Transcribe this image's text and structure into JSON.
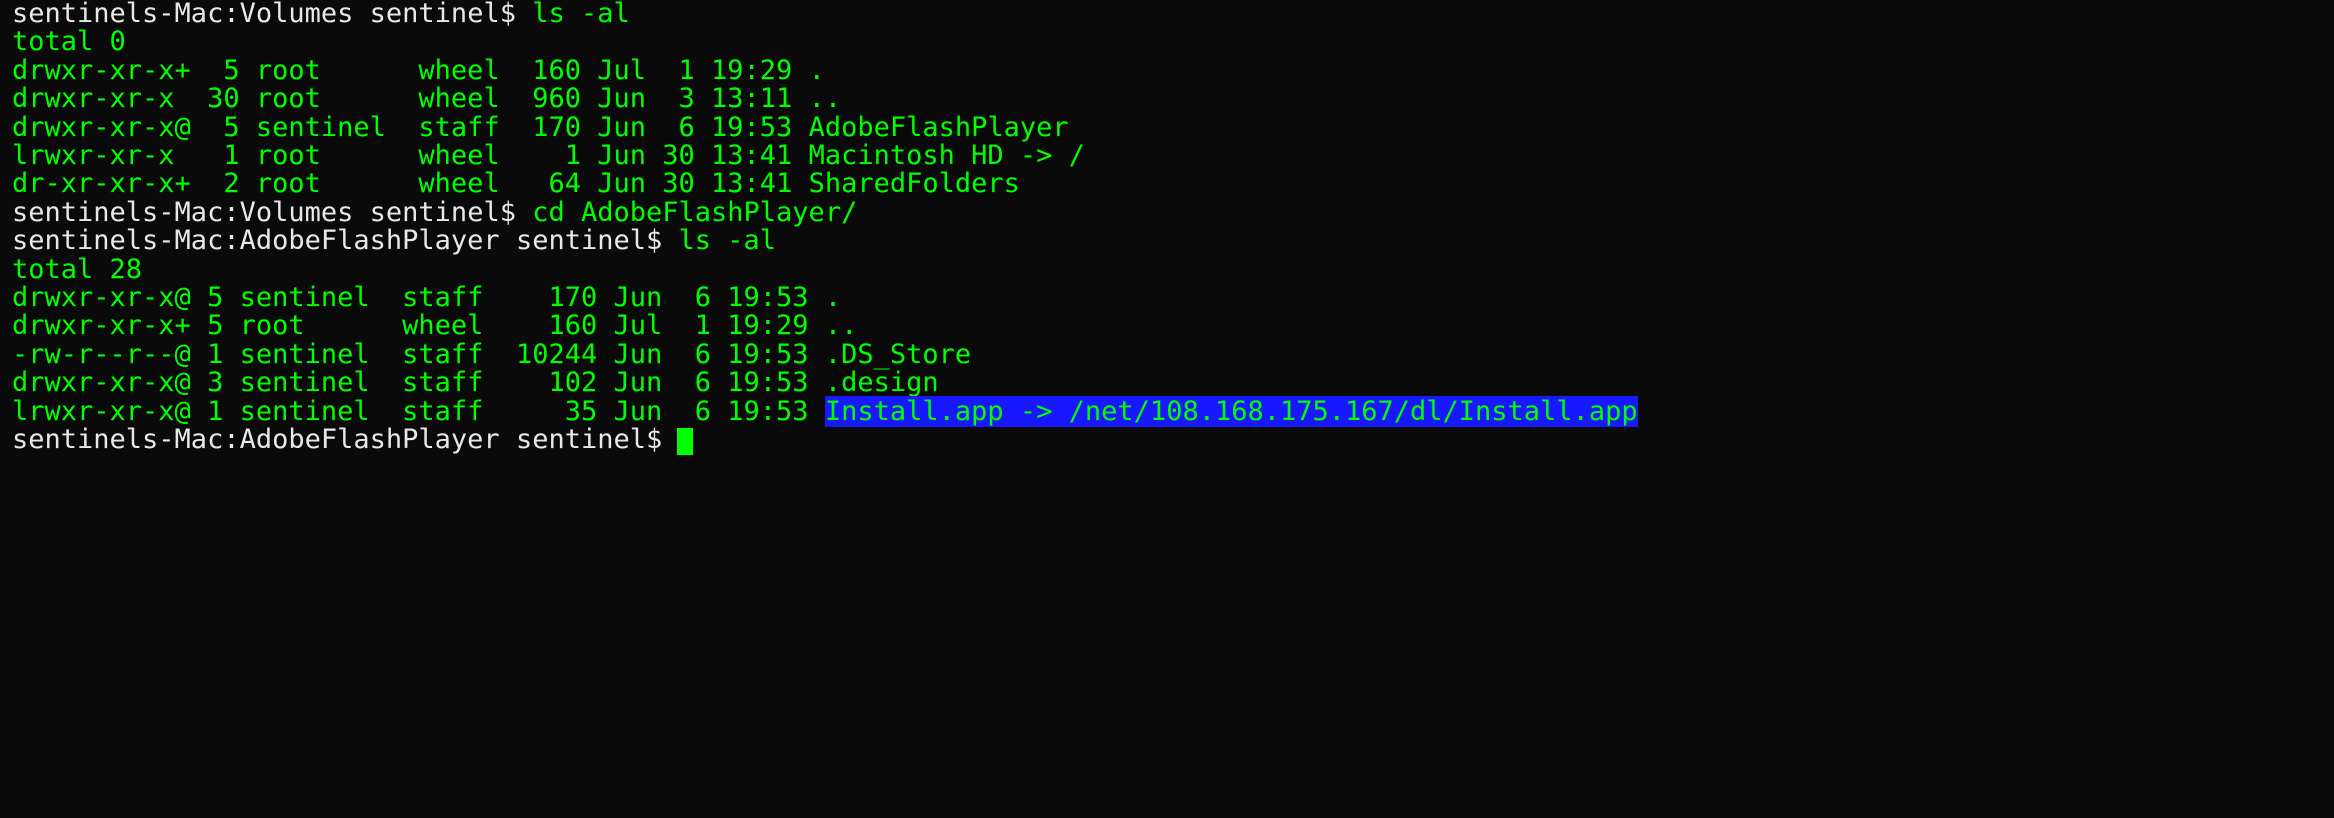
{
  "prompt1": {
    "host": "sentinels-Mac",
    "path": "Volumes",
    "user": "sentinel",
    "sym": "$",
    "cmd": "ls -al"
  },
  "ls1": {
    "total": "total 0",
    "rows": [
      {
        "perm": "drwxr-xr-x+",
        "n": " 5",
        "own": "root    ",
        "grp": "  wheel",
        "size": "  160",
        "date": "Jul  1 19:29",
        "name": "."
      },
      {
        "perm": "drwxr-xr-x ",
        "n": "30",
        "own": "root    ",
        "grp": "  wheel",
        "size": "  960",
        "date": "Jun  3 13:11",
        "name": ".."
      },
      {
        "perm": "drwxr-xr-x@",
        "n": " 5",
        "own": "sentinel",
        "grp": "  staff",
        "size": "  170",
        "date": "Jun  6 19:53",
        "name": "AdobeFlashPlayer"
      },
      {
        "perm": "lrwxr-xr-x ",
        "n": " 1",
        "own": "root    ",
        "grp": "  wheel",
        "size": "    1",
        "date": "Jun 30 13:41",
        "name": "Macintosh HD -> /"
      },
      {
        "perm": "dr-xr-xr-x+",
        "n": " 2",
        "own": "root    ",
        "grp": "  wheel",
        "size": "   64",
        "date": "Jun 30 13:41",
        "name": "SharedFolders"
      }
    ]
  },
  "prompt2": {
    "host": "sentinels-Mac",
    "path": "Volumes",
    "user": "sentinel",
    "sym": "$",
    "cmd": "cd AdobeFlashPlayer/"
  },
  "prompt3": {
    "host": "sentinels-Mac",
    "path": "AdobeFlashPlayer",
    "user": "sentinel",
    "sym": "$",
    "cmd": "ls -al"
  },
  "ls2": {
    "total": "total 28",
    "rows": [
      {
        "perm": "drwxr-xr-x@",
        "n": "5",
        "own": "sentinel",
        "grp": "  staff",
        "size": "    170",
        "date": "Jun  6 19:53",
        "name": "."
      },
      {
        "perm": "drwxr-xr-x+",
        "n": "5",
        "own": "root    ",
        "grp": "  wheel",
        "size": "    160",
        "date": "Jul  1 19:29",
        "name": ".."
      },
      {
        "perm": "-rw-r--r--@",
        "n": "1",
        "own": "sentinel",
        "grp": "  staff",
        "size": "  10244",
        "date": "Jun  6 19:53",
        "name": ".DS_Store"
      },
      {
        "perm": "drwxr-xr-x@",
        "n": "3",
        "own": "sentinel",
        "grp": "  staff",
        "size": "    102",
        "date": "Jun  6 19:53",
        "name": ".design"
      },
      {
        "perm": "lrwxr-xr-x@",
        "n": "1",
        "own": "sentinel",
        "grp": "  staff",
        "size": "     35",
        "date": "Jun  6 19:53",
        "name": "Install.app -> /net/108.168.175.167/dl/Install.app",
        "highlight": true
      }
    ]
  },
  "prompt4": {
    "host": "sentinels-Mac",
    "path": "AdobeFlashPlayer",
    "user": "sentinel",
    "sym": "$",
    "cmd": ""
  }
}
